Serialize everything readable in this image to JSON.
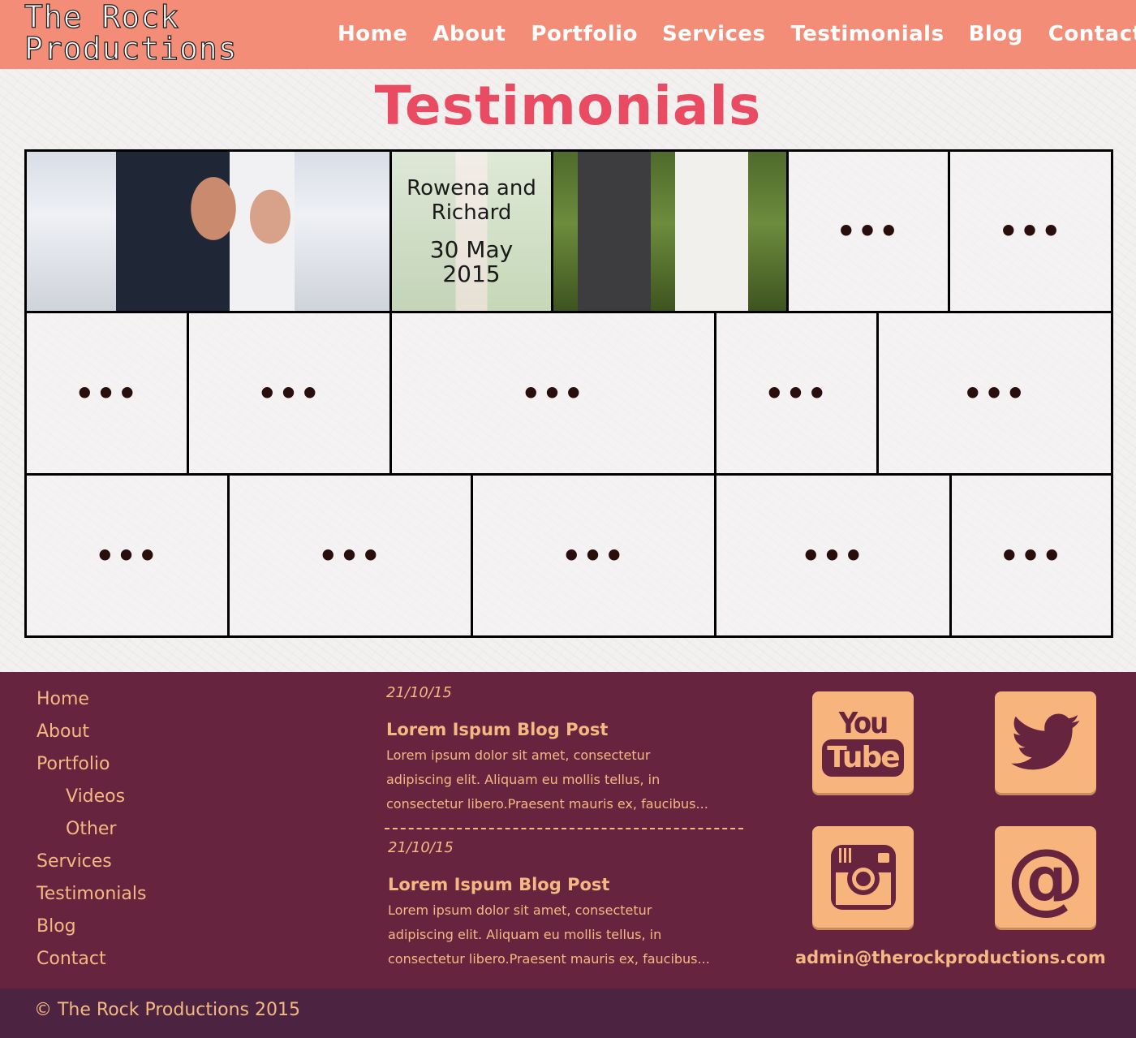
{
  "header": {
    "logo_line1": "The Rock",
    "logo_line2": "Productions",
    "nav": [
      "Home",
      "About",
      "Portfolio",
      "Services",
      "Testimonials",
      "Blog",
      "Contact"
    ]
  },
  "main": {
    "title": "Testimonials",
    "featured": {
      "names": "Rowena and Richard",
      "names_line1": "Rowena and",
      "names_line2": "Richard",
      "date_line1": "30 May",
      "date_line2": "2015"
    },
    "placeholder": "•••"
  },
  "footer": {
    "nav": {
      "home": "Home",
      "about": "About",
      "portfolio": "Portfolio",
      "videos": "Videos",
      "other": "Other",
      "services": "Services",
      "testimonials": "Testimonials",
      "blog": "Blog",
      "contact": "Contact"
    },
    "posts": [
      {
        "date": "21/10/15",
        "title": "Lorem Ispum Blog Post",
        "excerpt_line1": "Lorem ipsum dolor sit amet, consectetur",
        "excerpt_line2": "adipiscing elit. Aliquam eu mollis tellus, in",
        "excerpt_line3": "consectetur libero.Praesent mauris ex, faucibus..."
      },
      {
        "date": "21/10/15",
        "title": "Lorem Ispum Blog Post",
        "excerpt_line1": "Lorem ipsum dolor sit amet, consectetur",
        "excerpt_line2": "adipiscing elit. Aliquam eu mollis tellus, in",
        "excerpt_line3": "consectetur libero.Praesent mauris ex, faucibus..."
      }
    ],
    "social": {
      "youtube_you": "You",
      "youtube_tube": "Tube",
      "twitter_icon": "twitter-bird-icon",
      "instagram_icon": "instagram-camera-icon",
      "email_icon": "at-sign-icon",
      "at_symbol": "@"
    },
    "email": "admin@therockproductions.com",
    "copyright": "© The Rock Productions 2015"
  },
  "colors": {
    "header_bg": "#f48d78",
    "title": "#e94b62",
    "footer_bg": "#67243e",
    "footer_text": "#f4b882",
    "copyright_bg": "#4c2442",
    "social_tile": "#f7b47c"
  }
}
